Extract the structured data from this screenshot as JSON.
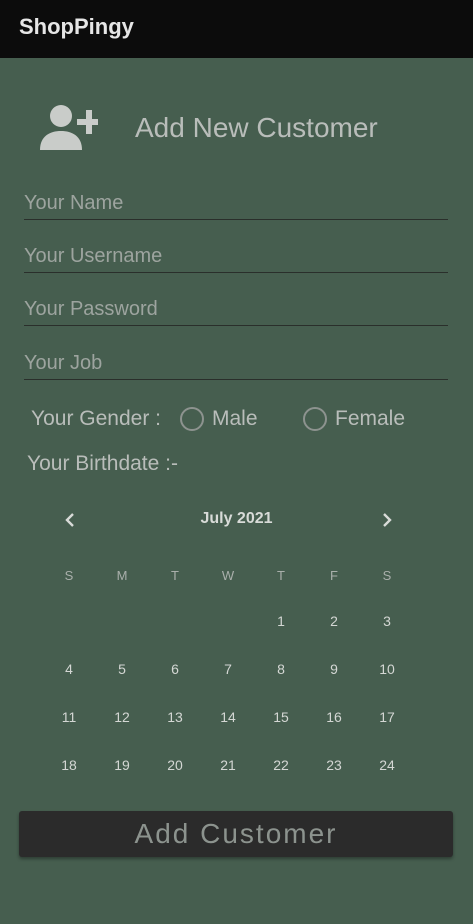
{
  "app_bar": {
    "title": "ShopPingy"
  },
  "header": {
    "icon": "person-add-icon",
    "title": "Add New Customer"
  },
  "form": {
    "name_placeholder": "Your Name",
    "username_placeholder": "Your Username",
    "password_placeholder": "Your Password",
    "job_placeholder": "Your Job",
    "gender": {
      "label": "Your Gender :",
      "options": [
        "Male",
        "Female"
      ],
      "selected": null
    },
    "birthdate_label": "Your Birthdate :-"
  },
  "calendar": {
    "month_label": "July 2021",
    "prev_icon": "chevron-left-icon",
    "next_icon": "chevron-right-icon",
    "weekdays": [
      "S",
      "M",
      "T",
      "W",
      "T",
      "F",
      "S"
    ],
    "weeks": [
      [
        "",
        "",
        "",
        "",
        "1",
        "2",
        "3"
      ],
      [
        "4",
        "5",
        "6",
        "7",
        "8",
        "9",
        "10"
      ],
      [
        "11",
        "12",
        "13",
        "14",
        "15",
        "16",
        "17"
      ],
      [
        "18",
        "19",
        "20",
        "21",
        "22",
        "23",
        "24"
      ]
    ]
  },
  "submit_label": "Add Customer",
  "colors": {
    "background": "#465e4f",
    "app_bar": "#0c0c0c",
    "button": "#2b2b2b"
  }
}
